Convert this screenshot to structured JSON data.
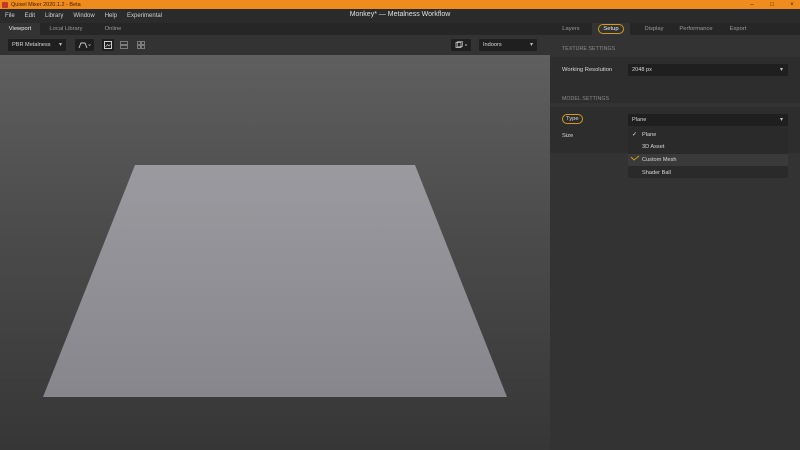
{
  "window": {
    "app_title": "Quixel Mixer 2020.1.2 - Beta",
    "document_title": "Monkey* — Metalness Workflow",
    "controls": [
      "–",
      "□",
      "×"
    ]
  },
  "menu": {
    "items": [
      "File",
      "Edit",
      "Library",
      "Window",
      "Help",
      "Experimental"
    ]
  },
  "left_tabs": [
    "Viewport",
    "Local Library",
    "Online"
  ],
  "toolbar": {
    "material_dropdown": "PBR Metalness",
    "environment_dropdown": "Indoors",
    "icons": [
      "camera-view-icon",
      "single-view-icon",
      "split-view-icon",
      "grid-view-icon",
      "render-mode-icon"
    ]
  },
  "right_tabs": [
    "Layers",
    "Setup",
    "Display",
    "Performance",
    "Export"
  ],
  "texture_settings": {
    "header": "TEXTURE SETTINGS",
    "working_resolution_label": "Working Resolution",
    "working_resolution_value": "2048 px"
  },
  "model_settings": {
    "header": "MODEL SETTINGS",
    "type_label": "Type",
    "type_value": "Plane",
    "size_label": "Size",
    "options": [
      "Plane",
      "3D Asset",
      "Custom Mesh",
      "Shader Ball"
    ]
  },
  "colors": {
    "accent": "#f08c1e",
    "highlight_annotation": "#d49a1e"
  }
}
